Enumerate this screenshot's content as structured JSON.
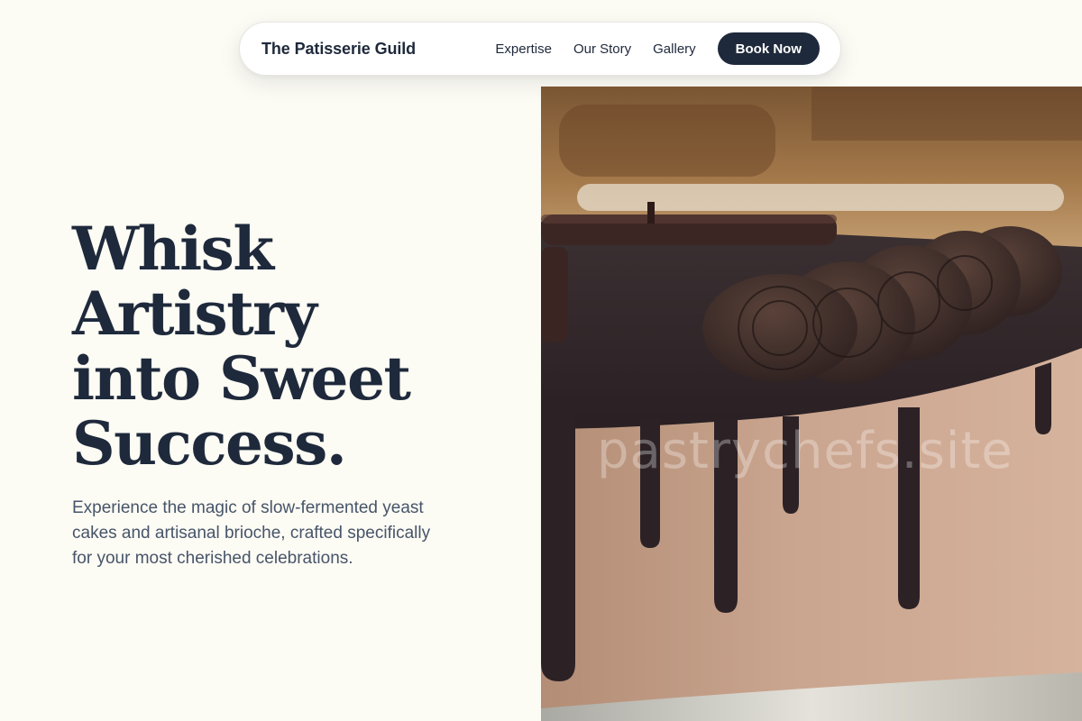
{
  "header": {
    "brand": "The Patisserie Guild",
    "links": [
      {
        "label": "Expertise"
      },
      {
        "label": "Our Story"
      },
      {
        "label": "Gallery"
      }
    ],
    "cta_label": "Book Now"
  },
  "hero": {
    "headline_lines": [
      "Whisk",
      "Artistry",
      "into Sweet",
      "Success."
    ],
    "subtext": "Experience the magic of slow-fermented yeast cakes and artisanal brioche, crafted specifically for your most cherished celebrations.",
    "image": {
      "subject": "chocolate drip cake topped with chocolate sandwich cookies",
      "watermark": "pastrychefs.site"
    }
  },
  "colors": {
    "page_background": "#fcfbf4",
    "primary_text": "#1e293b",
    "secondary_text": "#475569",
    "button_background": "#1e293b",
    "button_text": "#ffffff"
  }
}
